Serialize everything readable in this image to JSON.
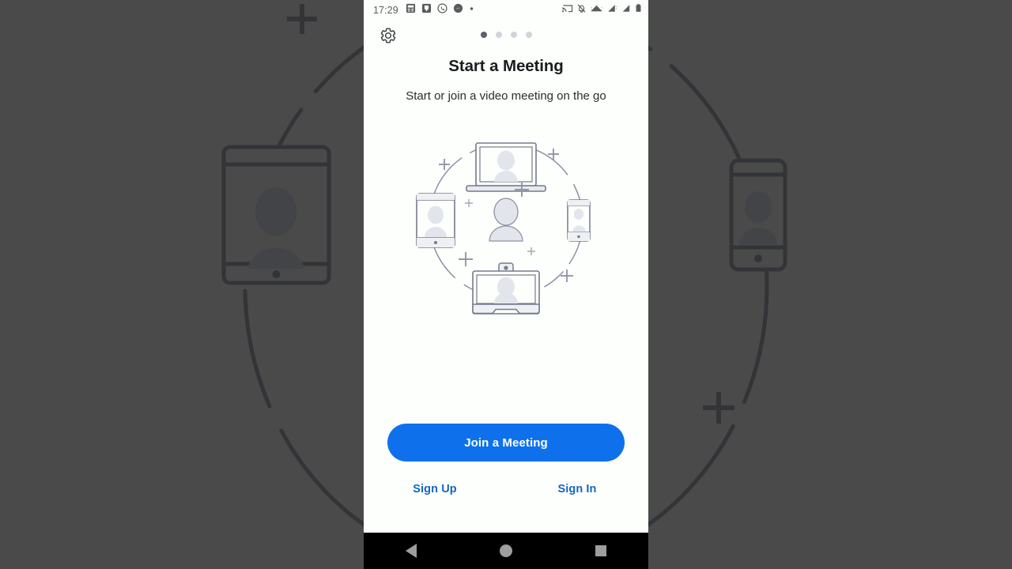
{
  "window": {
    "background_color": "#4a4a4a",
    "app_surface_color": "#fdfffc"
  },
  "status_bar": {
    "clock": "17:29",
    "left_icons": [
      "calculator-icon",
      "app-notification-icon",
      "whatsapp-icon",
      "messenger-icon",
      "more-notifications-dot-icon"
    ],
    "right_icons": [
      "cast-icon",
      "notifications-muted-icon",
      "wifi-icon",
      "signal-sim1-icon",
      "signal-sim2-icon",
      "battery-icon"
    ]
  },
  "top_bar": {
    "settings_icon": "gear-icon",
    "page_indicator": {
      "total": 4,
      "active_index": 0,
      "active_color": "#5d6073",
      "inactive_color": "#d2d4da"
    }
  },
  "onboarding": {
    "title": "Start a Meeting",
    "subtitle": "Start or join a video meeting on the go",
    "illustration": {
      "name": "video-meeting-devices-illustration",
      "center": "person-avatar-icon",
      "devices": [
        "laptop-icon",
        "tablet-icon",
        "smartphone-icon",
        "tv-monitor-icon"
      ],
      "decorations": [
        "plus-mark",
        "dashed-circle"
      ],
      "line_color": "#757a8c",
      "fill_color": "#e3e5ec"
    }
  },
  "actions": {
    "primary_button_label": "Join a Meeting",
    "primary_button_color": "#0e71eb",
    "sign_up_label": "Sign Up",
    "sign_in_label": "Sign In",
    "link_color": "#1565c5"
  },
  "navigation_bar": {
    "background_color": "#000000",
    "buttons": [
      {
        "name": "back-button",
        "icon": "triangle-back-icon"
      },
      {
        "name": "home-button",
        "icon": "circle-home-icon"
      },
      {
        "name": "recents-button",
        "icon": "square-recents-icon"
      }
    ]
  }
}
